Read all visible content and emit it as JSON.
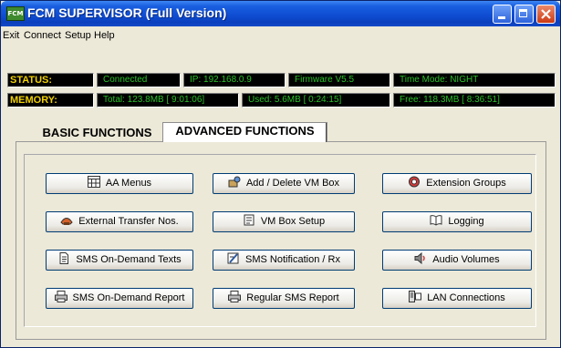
{
  "window": {
    "title": "FCM SUPERVISOR (Full Version)",
    "app_icon_text": "FCM"
  },
  "menu": [
    "Exit",
    "Connect",
    "Setup",
    "Help"
  ],
  "status": {
    "label": "STATUS:",
    "connection": "Connected",
    "ip": "IP: 192.168.0.9",
    "firmware": "Firmware V5.5",
    "time_mode": "Time Mode:  NIGHT"
  },
  "memory": {
    "label": "MEMORY:",
    "total": "Total: 123.8MB [ 9:01:06]",
    "used": "Used:  5.6MB [ 0:24:15]",
    "free": "Free: 118.3MB [ 8:36:51]"
  },
  "tabs": [
    {
      "label": "BASIC FUNCTIONS",
      "active": false
    },
    {
      "label": "ADVANCED FUNCTIONS",
      "active": true
    }
  ],
  "buttons": [
    {
      "label": "AA Menus",
      "icon": "menu-grid-icon"
    },
    {
      "label": "Add / Delete VM Box",
      "icon": "vm-box-add-icon"
    },
    {
      "label": "Extension Groups",
      "icon": "extension-groups-icon"
    },
    {
      "label": "External Transfer Nos.",
      "icon": "phone-transfer-icon"
    },
    {
      "label": "VM Box Setup",
      "icon": "vm-box-setup-icon"
    },
    {
      "label": "Logging",
      "icon": "logging-book-icon"
    },
    {
      "label": "SMS On-Demand Texts",
      "icon": "document-icon"
    },
    {
      "label": "SMS Notification / Rx",
      "icon": "notification-edit-icon"
    },
    {
      "label": "Audio Volumes",
      "icon": "speaker-icon"
    },
    {
      "label": "SMS On-Demand Report",
      "icon": "printer-icon"
    },
    {
      "label": "Regular SMS Report",
      "icon": "printer-icon"
    },
    {
      "label": "LAN Connections",
      "icon": "network-icon"
    }
  ],
  "colors": {
    "title_bar": "#0f4ed3",
    "status_label": "#f0d000",
    "status_value": "#29c229",
    "window_face": "#ece9d8"
  }
}
